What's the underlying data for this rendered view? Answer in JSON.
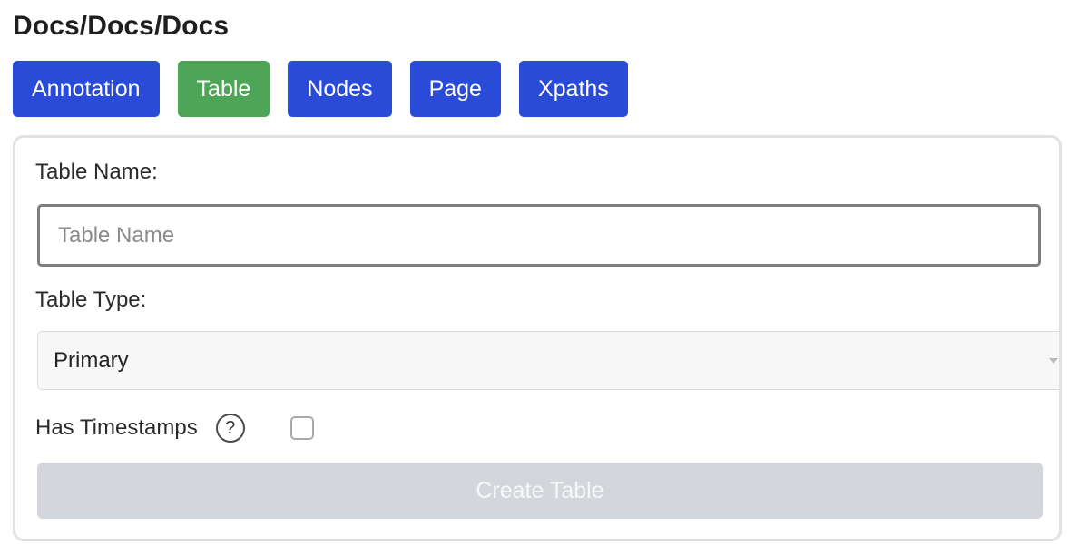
{
  "page": {
    "title": "Docs/Docs/Docs"
  },
  "tabs": [
    {
      "label": "Annotation",
      "active": false
    },
    {
      "label": "Table",
      "active": true
    },
    {
      "label": "Nodes",
      "active": false
    },
    {
      "label": "Page",
      "active": false
    },
    {
      "label": "Xpaths",
      "active": false
    }
  ],
  "form": {
    "table_name_label": "Table Name:",
    "table_name_value": "",
    "table_name_placeholder": "Table Name",
    "table_type_label": "Table Type:",
    "table_type_selected": "Primary",
    "has_timestamps_label": "Has Timestamps",
    "has_timestamps_checked": false,
    "help_icon_glyph": "?",
    "create_button_label": "Create Table",
    "create_button_disabled": true
  },
  "icons": {
    "help": "question-circle-icon",
    "select_arrow": "chevron-down-icon"
  },
  "colors": {
    "tab_blue": "#2a4bd7",
    "tab_active_green": "#4ea457",
    "button_disabled": "#d3d6db"
  }
}
